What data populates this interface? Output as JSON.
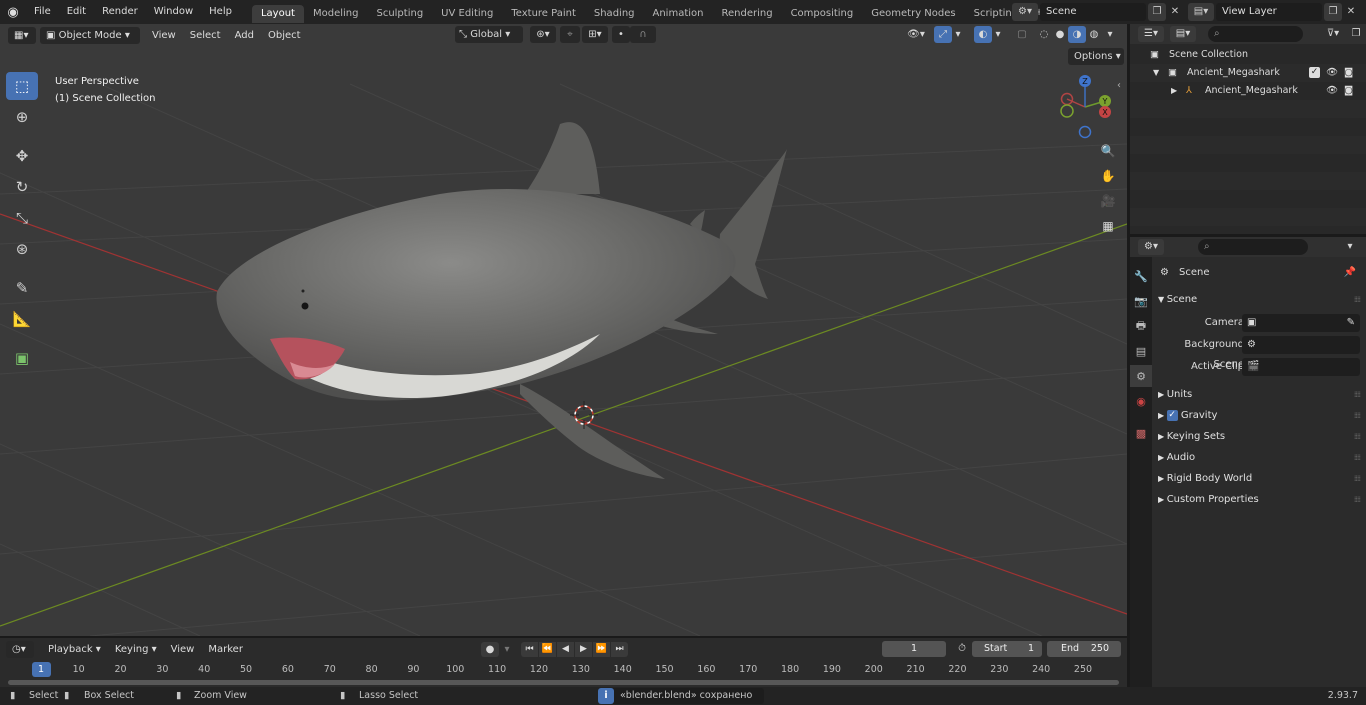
{
  "menus": [
    "File",
    "Edit",
    "Render",
    "Window",
    "Help"
  ],
  "workspaces": [
    "Layout",
    "Modeling",
    "Sculpting",
    "UV Editing",
    "Texture Paint",
    "Shading",
    "Animation",
    "Rendering",
    "Compositing",
    "Geometry Nodes",
    "Scripting"
  ],
  "active_workspace": "Layout",
  "scene_name": "Scene",
  "view_layer": "View Layer",
  "viewport": {
    "mode": "Object Mode",
    "menus": [
      "View",
      "Select",
      "Add",
      "Object"
    ],
    "transform_orientation": "Global",
    "options_label": "Options",
    "perspective_label": "User Perspective",
    "collection_label": "(1) Scene Collection"
  },
  "outliner": {
    "root": "Scene Collection",
    "collection": "Ancient_Megashark",
    "object": "Ancient_Megashark"
  },
  "properties": {
    "context": "Scene",
    "panel": "Scene",
    "camera_label": "Camera",
    "background_scene_label": "Background Scene",
    "active_clip_label": "Active Clip",
    "panels": [
      "Units",
      "Gravity",
      "Keying Sets",
      "Audio",
      "Rigid Body World",
      "Custom Properties"
    ]
  },
  "timeline": {
    "menus": [
      "Playback",
      "Keying",
      "View",
      "Marker"
    ],
    "current_frame": "1",
    "start_label": "Start",
    "start": "1",
    "end_label": "End",
    "end": "250",
    "ticks": [
      "1",
      "10",
      "20",
      "30",
      "40",
      "50",
      "60",
      "70",
      "80",
      "90",
      "100",
      "110",
      "120",
      "130",
      "140",
      "150",
      "160",
      "170",
      "180",
      "190",
      "200",
      "210",
      "220",
      "230",
      "240",
      "250"
    ]
  },
  "statusbar": {
    "select": "Select",
    "box_select": "Box Select",
    "zoom_view": "Zoom View",
    "lasso_select": "Lasso Select",
    "message": "«blender.blend» сохранено",
    "version": "2.93.7"
  },
  "colors": {
    "accent": "#4772b3",
    "x_axis": "#c23b3b",
    "y_axis": "#7a9a2a"
  }
}
